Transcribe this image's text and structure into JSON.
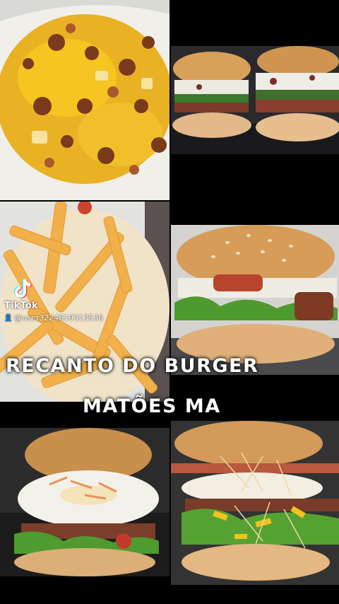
{
  "watermark": {
    "brand": "TikTok",
    "username": "@user3224619313536",
    "logo_icon": "tiktok-note-icon",
    "user_icon": "person-icon"
  },
  "overlay_text": {
    "line1": "RECANTO DO BURGER",
    "line2": "MATÕES MA"
  },
  "photos": [
    {
      "name": "fries-with-cheese-and-bacon"
    },
    {
      "name": "two-burgers-with-sauce"
    },
    {
      "name": "plain-french-fries"
    },
    {
      "name": "burger-with-lettuce-and-cheese"
    },
    {
      "name": "burger-with-fried-egg"
    },
    {
      "name": "loaded-burger-with-egg-and-straw-potatoes"
    }
  ]
}
